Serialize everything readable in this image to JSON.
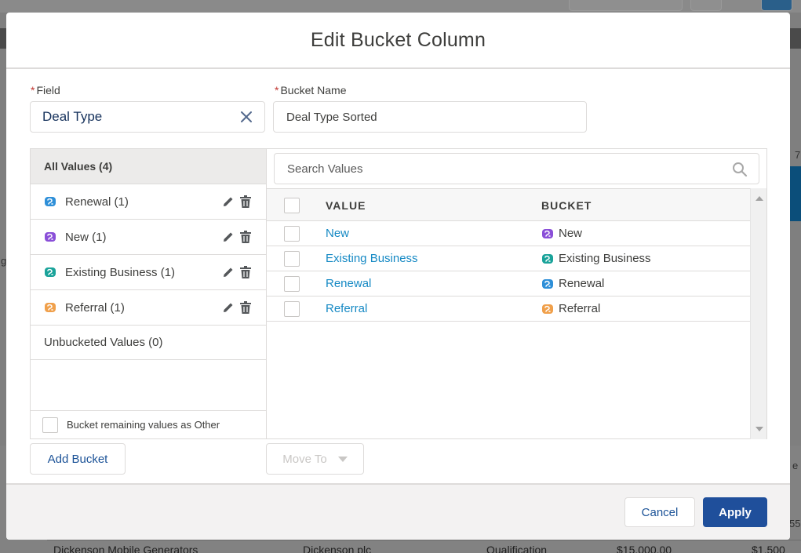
{
  "background": {
    "table_row": [
      "Dickenson Mobile Generators",
      "Dickenson plc",
      "Qualification",
      "$15,000.00",
      "$1,500"
    ],
    "side_fragments": [
      "7",
      "e",
      "55",
      "g"
    ]
  },
  "modal": {
    "title": "Edit Bucket Column",
    "field": {
      "required_mark": "*",
      "label": "Field",
      "value": "Deal Type"
    },
    "bucket_name": {
      "required_mark": "*",
      "label": "Bucket Name",
      "value": "Deal Type Sorted"
    },
    "buckets": {
      "all_values_label": "All Values (4)",
      "items": [
        {
          "label": "Renewal (1)",
          "color": "#2e8fd8"
        },
        {
          "label": "New (1)",
          "color": "#8a4fd8"
        },
        {
          "label": "Existing Business (1)",
          "color": "#1aa39a"
        },
        {
          "label": "Referral (1)",
          "color": "#f0a04b"
        }
      ],
      "unbucketed_label": "Unbucketed Values (0)",
      "remaining_label": "Bucket remaining values as Other"
    },
    "search": {
      "placeholder": "Search Values"
    },
    "table": {
      "headers": {
        "value": "VALUE",
        "bucket": "BUCKET"
      },
      "rows": [
        {
          "value": "New",
          "bucket": "New",
          "color": "#8a4fd8"
        },
        {
          "value": "Existing Business",
          "bucket": "Existing Business",
          "color": "#1aa39a"
        },
        {
          "value": "Renewal",
          "bucket": "Renewal",
          "color": "#2e8fd8"
        },
        {
          "value": "Referral",
          "bucket": "Referral",
          "color": "#f0a04b"
        }
      ]
    },
    "buttons": {
      "add_bucket": "Add Bucket",
      "move_to": "Move To",
      "cancel": "Cancel",
      "apply": "Apply"
    },
    "colors": {
      "primary": "#1f4f9b",
      "link": "#1589c4",
      "border": "#dddbda"
    }
  }
}
